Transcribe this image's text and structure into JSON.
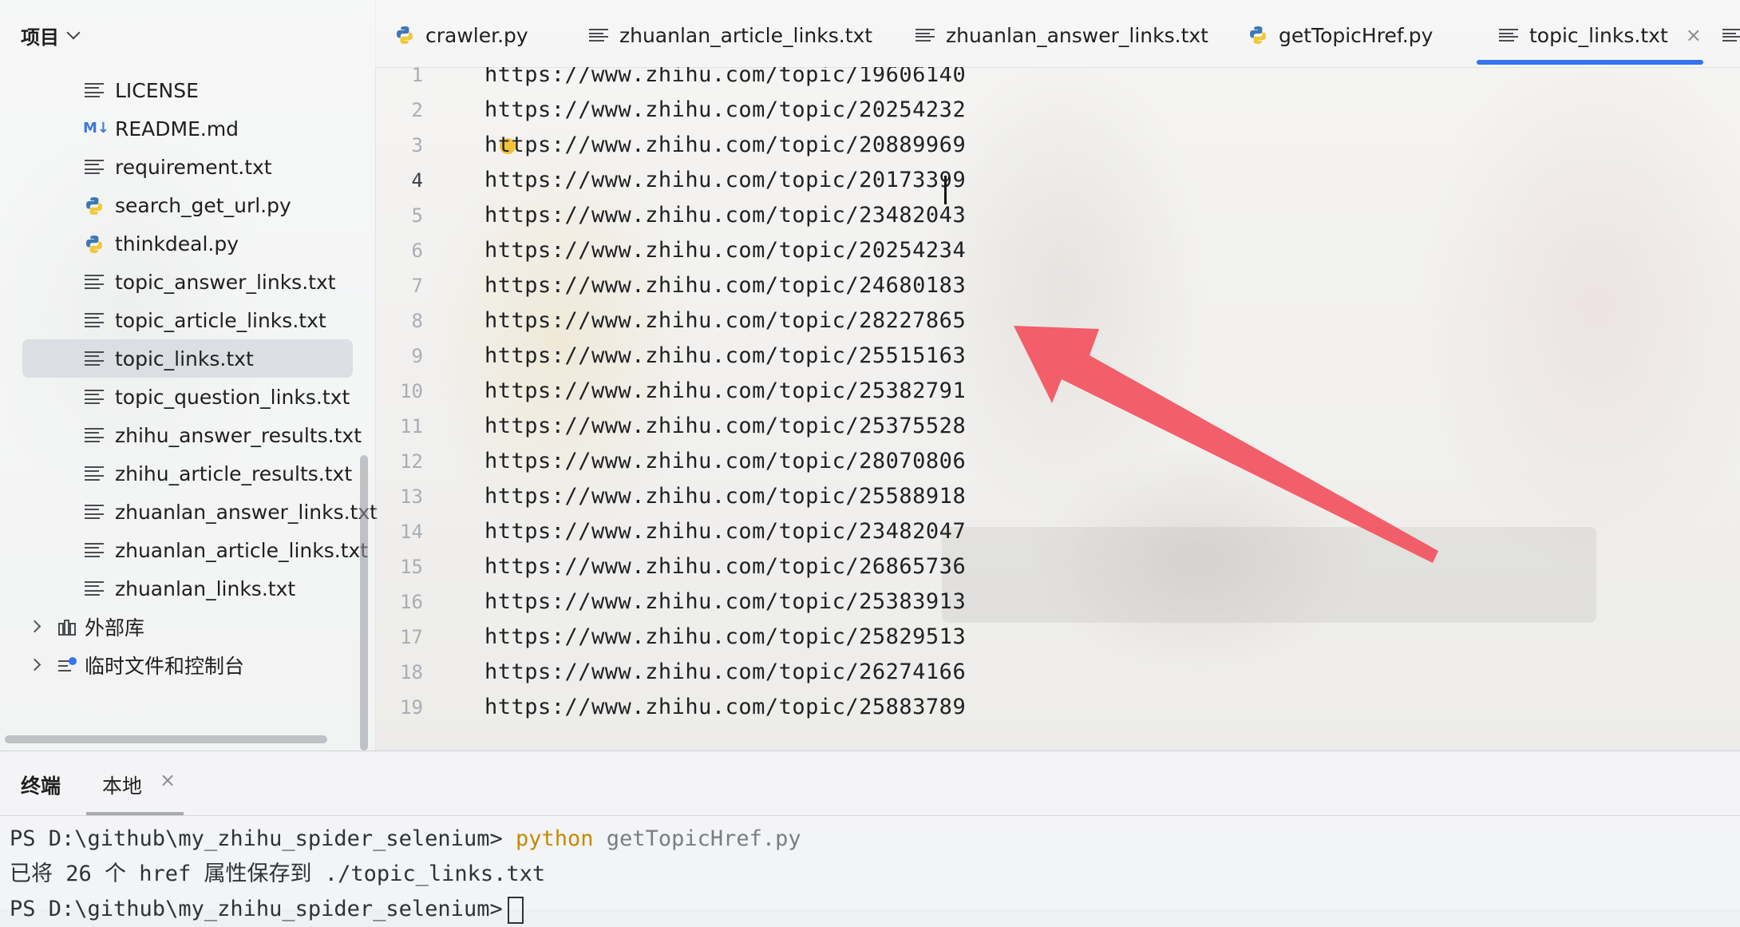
{
  "sidebar": {
    "title": "项目",
    "files": [
      {
        "label": "LICENSE",
        "icon": "text-file-icon"
      },
      {
        "label": "README.md",
        "icon": "markdown-file-icon",
        "badge": "M↓"
      },
      {
        "label": "requirement.txt",
        "icon": "text-file-icon"
      },
      {
        "label": "search_get_url.py",
        "icon": "python-file-icon"
      },
      {
        "label": "thinkdeal.py",
        "icon": "python-file-icon"
      },
      {
        "label": "topic_answer_links.txt",
        "icon": "text-file-icon"
      },
      {
        "label": "topic_article_links.txt",
        "icon": "text-file-icon"
      },
      {
        "label": "topic_links.txt",
        "icon": "text-file-icon",
        "selected": true
      },
      {
        "label": "topic_question_links.txt",
        "icon": "text-file-icon"
      },
      {
        "label": "zhihu_answer_results.txt",
        "icon": "text-file-icon"
      },
      {
        "label": "zhihu_article_results.txt",
        "icon": "text-file-icon"
      },
      {
        "label": "zhuanlan_answer_links.txt",
        "icon": "text-file-icon"
      },
      {
        "label": "zhuanlan_article_links.txt",
        "icon": "text-file-icon"
      },
      {
        "label": "zhuanlan_links.txt",
        "icon": "text-file-icon"
      }
    ],
    "tree": [
      {
        "label": "外部库",
        "icon": "library-icon"
      },
      {
        "label": "临时文件和控制台",
        "icon": "scratches-icon"
      }
    ]
  },
  "tabs": [
    {
      "label": "crawler.py",
      "icon": "python-file-icon"
    },
    {
      "label": "zhuanlan_article_links.txt",
      "icon": "text-file-icon"
    },
    {
      "label": "zhuanlan_answer_links.txt",
      "icon": "text-file-icon"
    },
    {
      "label": "getTopicHref.py",
      "icon": "python-file-icon"
    },
    {
      "label": "topic_links.txt",
      "icon": "text-file-icon",
      "active": true,
      "close": "×"
    }
  ],
  "editor": {
    "current_line": 4,
    "lines": [
      {
        "n": "1",
        "text": "https://www.zhihu.com/topic/19606140"
      },
      {
        "n": "2",
        "text": "https://www.zhihu.com/topic/20254232"
      },
      {
        "n": "3",
        "text": "https://www.zhihu.com/topic/20889969"
      },
      {
        "n": "4",
        "text": "https://www.zhihu.com/topic/20173399"
      },
      {
        "n": "5",
        "text": "https://www.zhihu.com/topic/23482043"
      },
      {
        "n": "6",
        "text": "https://www.zhihu.com/topic/20254234"
      },
      {
        "n": "7",
        "text": "https://www.zhihu.com/topic/24680183"
      },
      {
        "n": "8",
        "text": "https://www.zhihu.com/topic/28227865"
      },
      {
        "n": "9",
        "text": "https://www.zhihu.com/topic/25515163"
      },
      {
        "n": "10",
        "text": "https://www.zhihu.com/topic/25382791"
      },
      {
        "n": "11",
        "text": "https://www.zhihu.com/topic/25375528"
      },
      {
        "n": "12",
        "text": "https://www.zhihu.com/topic/28070806"
      },
      {
        "n": "13",
        "text": "https://www.zhihu.com/topic/25588918"
      },
      {
        "n": "14",
        "text": "https://www.zhihu.com/topic/23482047"
      },
      {
        "n": "15",
        "text": "https://www.zhihu.com/topic/26865736"
      },
      {
        "n": "16",
        "text": "https://www.zhihu.com/topic/25383913"
      },
      {
        "n": "17",
        "text": "https://www.zhihu.com/topic/25829513"
      },
      {
        "n": "18",
        "text": "https://www.zhihu.com/topic/26274166"
      },
      {
        "n": "19",
        "text": "https://www.zhihu.com/topic/25883789"
      }
    ]
  },
  "terminal": {
    "title": "终端",
    "tab_label": "本地",
    "tab_close": "×",
    "prompt1": "PS D:\\github\\my_zhihu_spider_selenium>",
    "command": "python",
    "command_arg": "getTopicHref.py",
    "output": "已将 26 个 href 属性保存到 ./topic_links.txt",
    "prompt2": "PS D:\\github\\my_zhihu_spider_selenium>"
  },
  "colors": {
    "accent": "#3574f0",
    "arrow": "#f2525e",
    "python_blue": "#3d78b5",
    "python_yellow": "#f0c93a"
  }
}
